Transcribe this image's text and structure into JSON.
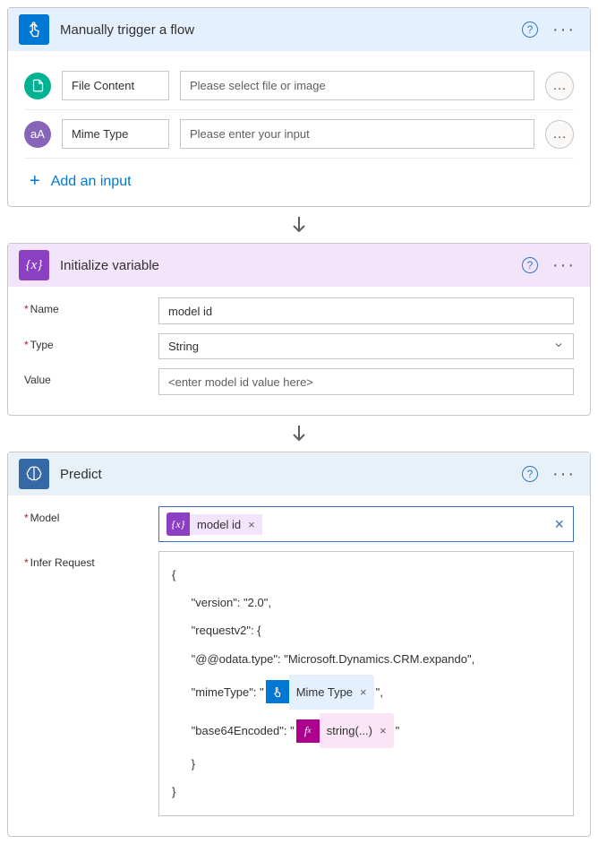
{
  "trigger": {
    "title": "Manually trigger a flow",
    "inputs": [
      {
        "label": "File Content",
        "placeholder": "Please select file or image",
        "icon": "file"
      },
      {
        "label": "Mime Type",
        "placeholder": "Please enter your input",
        "icon": "text"
      }
    ],
    "add_label": "Add an input"
  },
  "variable": {
    "title": "Initialize variable",
    "fields": {
      "name_label": "Name",
      "name_value": "model id",
      "type_label": "Type",
      "type_value": "String",
      "value_label": "Value",
      "value_placeholder": "<enter model id value here>"
    }
  },
  "predict": {
    "title": "Predict",
    "fields": {
      "model_label": "Model",
      "model_token": "model id",
      "infer_label": "Infer Request",
      "json": {
        "l1": "{",
        "l2": "      \"version\": \"2.0\",",
        "l3": "      \"requestv2\": {",
        "l4": "      \"@@odata.type\": \"Microsoft.Dynamics.CRM.expando\",",
        "l5a": "      \"mimeType\": \"",
        "l5_token": "Mime Type",
        "l5b": "\",",
        "l6a": "      \"base64Encoded\": \"",
        "l6_token": "string(...)",
        "l6b": "\"",
        "l7": "      }",
        "l8": "}"
      }
    }
  }
}
